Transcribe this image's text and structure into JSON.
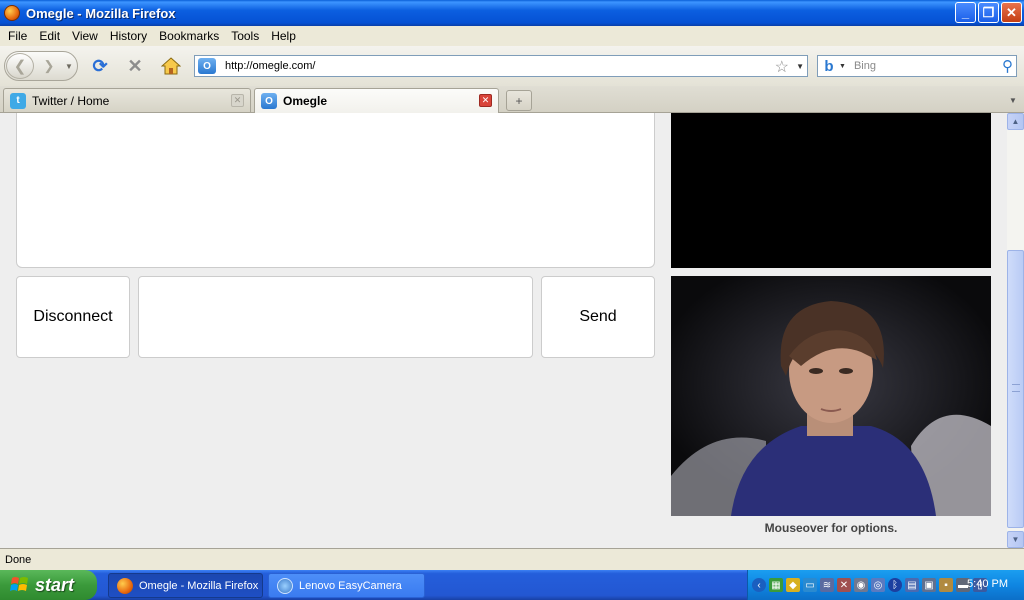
{
  "window": {
    "title": "Omegle - Mozilla Firefox",
    "controls": {
      "minimize": "_",
      "maximize": "❐",
      "close": "✕"
    }
  },
  "menu": {
    "items": [
      "File",
      "Edit",
      "View",
      "History",
      "Bookmarks",
      "Tools",
      "Help"
    ]
  },
  "navbar": {
    "url": "http://omegle.com/",
    "search_placeholder": "Bing",
    "icons": [
      "back-icon",
      "forward-icon",
      "reload-icon",
      "stop-icon",
      "home-icon",
      "bookmark-star-icon",
      "search-icon"
    ]
  },
  "tabs": [
    {
      "label": "Twitter / Home",
      "active": false,
      "icon": "twitter-icon"
    },
    {
      "label": "Omegle",
      "active": true,
      "icon": "omegle-icon"
    }
  ],
  "page": {
    "disconnect_label": "Disconnect",
    "send_label": "Send",
    "webcam_hint": "Mouseover for options."
  },
  "status": {
    "text": "Done"
  },
  "taskbar": {
    "start_label": "start",
    "tasks": [
      {
        "label": "Omegle - Mozilla Firefox",
        "active": true
      },
      {
        "label": "Lenovo EasyCamera",
        "active": false
      }
    ],
    "clock": "5:40 PM"
  },
  "colors": {
    "titlebar": "#0551d4",
    "page_background": "#eeeeee",
    "close_tab": "#d9443a",
    "start_button": "#3b9a3b"
  }
}
